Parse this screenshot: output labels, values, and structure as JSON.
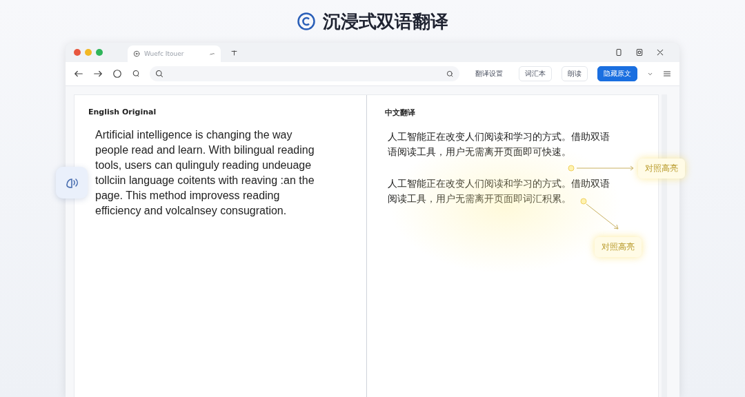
{
  "header": {
    "title": "沉浸式双语翻译"
  },
  "browser": {
    "tab": {
      "title": "Wuefc Itouer"
    },
    "toolbar_buttons": [
      {
        "label": "翻译设置",
        "kind": "text"
      },
      {
        "label": "词汇本",
        "kind": "outline"
      },
      {
        "label": "朗读",
        "kind": "outline"
      },
      {
        "label": "隐藏原文",
        "kind": "primary"
      }
    ]
  },
  "panels": [
    {
      "heading": "English Original",
      "paragraphs": [
        "Artificial intelligence is changing the way people read and learn. With bilingual reading tools, users can qulinguly reading undeuage tollciin language coitents with reaving :an the page. This method improvess reading efficiency and volcalnsey consugration."
      ]
    },
    {
      "heading": "中文翻译",
      "paragraphs": [
        "人工智能正在改变人们阅读和学习的方式。借助双语语阅读工具，用户无需离开页面即可快速。",
        "人工智能正在改变人们阅读和学习的方式。借助双语阅读工具，用户无需离开页面即词汇积累。"
      ]
    }
  ],
  "callouts": [
    {
      "label": "对照高亮",
      "kind": "right"
    },
    {
      "label": "对照高亮",
      "kind": "down"
    }
  ]
}
